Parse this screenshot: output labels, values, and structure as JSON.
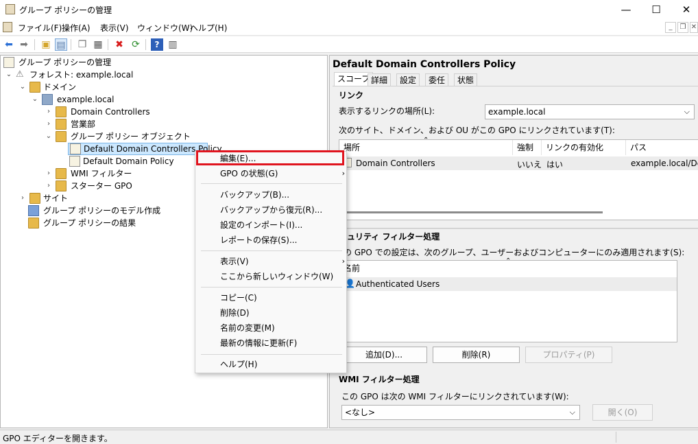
{
  "window": {
    "title": "グループ ポリシーの管理",
    "min": "—",
    "max": "☐",
    "close": "✕"
  },
  "menu": [
    "ファイル(F)",
    "操作(A)",
    "表示(V)",
    "ウィンドウ(W)",
    "ヘルプ(H)"
  ],
  "tree": {
    "root": "グループ ポリシーの管理",
    "forest": "フォレスト: example.local",
    "domains": "ドメイン",
    "domain": "example.local",
    "dc": "Domain Controllers",
    "sales": "営業部",
    "gpo_objects": "グループ ポリシー オブジェクト",
    "gpo1": "Default Domain Controllers Policy",
    "gpo2": "Default Domain Policy",
    "wmi": "WMI フィルター",
    "starter": "スターター GPO",
    "sites": "サイト",
    "modeling": "グループ ポリシーのモデル作成",
    "results": "グループ ポリシーの結果"
  },
  "context_menu": {
    "edit": "編集(E)...",
    "gpo_status": "GPO の状態(G)",
    "backup": "バックアップ(B)...",
    "restore": "バックアップから復元(R)...",
    "import": "設定のインポート(I)...",
    "save_report": "レポートの保存(S)...",
    "view": "表示(V)",
    "new_window": "ここから新しいウィンドウ(W)",
    "copy": "コピー(C)",
    "delete": "削除(D)",
    "rename": "名前の変更(M)",
    "refresh": "最新の情報に更新(F)",
    "help": "ヘルプ(H)"
  },
  "details": {
    "title": "Default Domain Controllers Policy",
    "tabs": [
      "スコープ",
      "詳細",
      "設定",
      "委任",
      "状態"
    ],
    "links_header": "リンク",
    "links_location_label": "表示するリンクの場所(L):",
    "links_location_value": "example.local",
    "links_desc": "次のサイト、ドメイン、および OU がこの GPO にリンクされています(T):",
    "links_columns": [
      "場所",
      "強制",
      "リンクの有効化",
      "パス"
    ],
    "links_row": {
      "location": "Domain Controllers",
      "enforced": "いいえ",
      "enabled": "はい",
      "path": "example.local/Dc"
    },
    "security_header": "キュリティ フィルター処理",
    "security_desc": "の GPO での設定は、次のグループ、ユーザーおよびコンピューターにのみ適用されます(S):",
    "security_column": "名前",
    "security_row": "Authenticated Users",
    "add_btn": "追加(D)...",
    "remove_btn": "削除(R)",
    "props_btn": "プロパティ(P)",
    "wmi_header": "WMI フィルター処理",
    "wmi_desc": "この GPO は次の WMI フィルターにリンクされています(W):",
    "wmi_value": "<なし>",
    "open_btn": "開く(O)"
  },
  "status": "GPO エディターを開きます。",
  "colors": {
    "accent_red": "#e0141e",
    "selection": "#cce8ff"
  }
}
